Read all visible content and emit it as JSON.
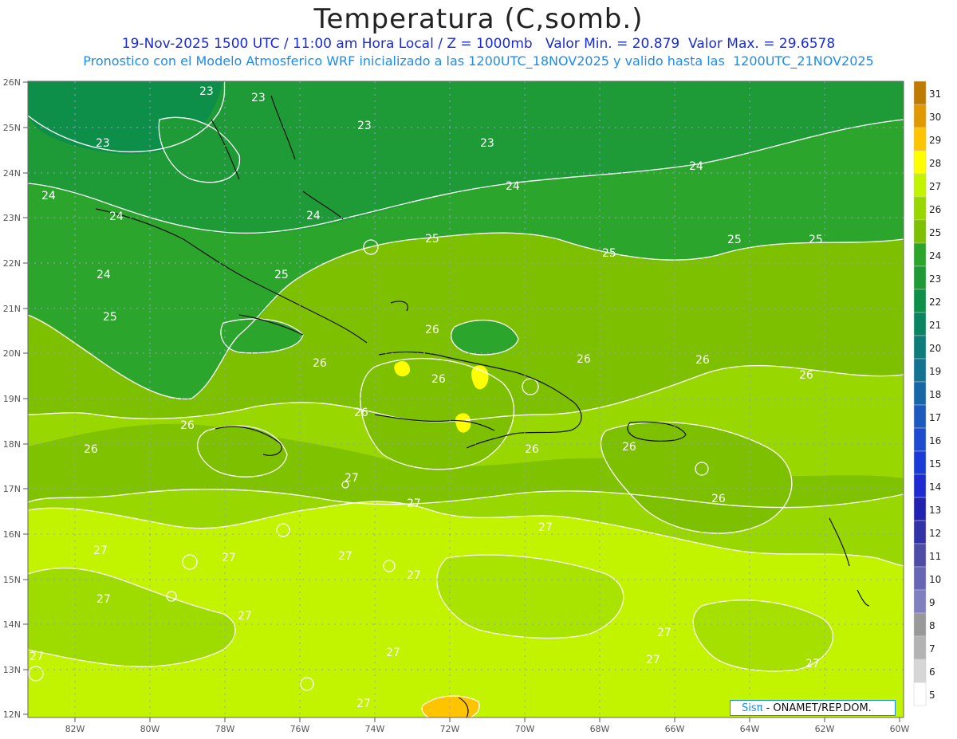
{
  "header": {
    "title": "Temperatura (C,somb.)",
    "line1": "19-Nov-2025 1500 UTC / 11:00 am Hora Local / Z = 1000mb   Valor Min. = 20.879  Valor Max. = 29.6578",
    "line2": "Pronostico con el Modelo Atmosferico WRF inicializado a las 1200UTC_18NOV2025 y valido hasta las  1200UTC_21NOV2025"
  },
  "map": {
    "lon_labels": [
      "82W",
      "80W",
      "78W",
      "76W",
      "74W",
      "72W",
      "70W",
      "68W",
      "66W",
      "64W",
      "62W",
      "60W"
    ],
    "lat_labels": [
      "26N",
      "25N",
      "24N",
      "23N",
      "22N",
      "21N",
      "20N",
      "19N",
      "18N",
      "17N",
      "16N",
      "15N",
      "14N",
      "13N",
      "12N"
    ],
    "contour_labels": [
      "23",
      "23",
      "23",
      "23",
      "23",
      "24",
      "24",
      "24",
      "24",
      "24",
      "24",
      "25",
      "25",
      "25",
      "25",
      "25",
      "25",
      "26",
      "26",
      "26",
      "26",
      "26",
      "26",
      "26",
      "26",
      "26",
      "26",
      "26",
      "26",
      "27",
      "27",
      "27",
      "27",
      "27",
      "27",
      "27",
      "27",
      "27",
      "27",
      "27",
      "27",
      "27",
      "27",
      "27"
    ]
  },
  "colorbar": {
    "levels": [
      "31",
      "30",
      "29",
      "28",
      "27",
      "26",
      "25",
      "24",
      "23",
      "22",
      "21",
      "20",
      "19",
      "18",
      "17",
      "16",
      "15",
      "14",
      "13",
      "12",
      "11",
      "10",
      "9",
      "8",
      "7",
      "6",
      "5"
    ],
    "colors": [
      "#c07a00",
      "#e09a00",
      "#ffc400",
      "#ffff00",
      "#c2f400",
      "#98d700",
      "#7cc000",
      "#2ca52c",
      "#1e9b36",
      "#0d8f4a",
      "#0b8561",
      "#0e7c78",
      "#137391",
      "#1766a8",
      "#1c5ac0",
      "#1d4cd0",
      "#1a3bd8",
      "#1d2bd0",
      "#2222b0",
      "#3333a8",
      "#4d4da8",
      "#6666b4",
      "#8080c0",
      "#999999",
      "#b3b3b3",
      "#d6d6d6",
      "#ffffff"
    ]
  },
  "logo": {
    "sis": "Sisπ",
    "org": " - ONAMET/REP.DOM."
  }
}
